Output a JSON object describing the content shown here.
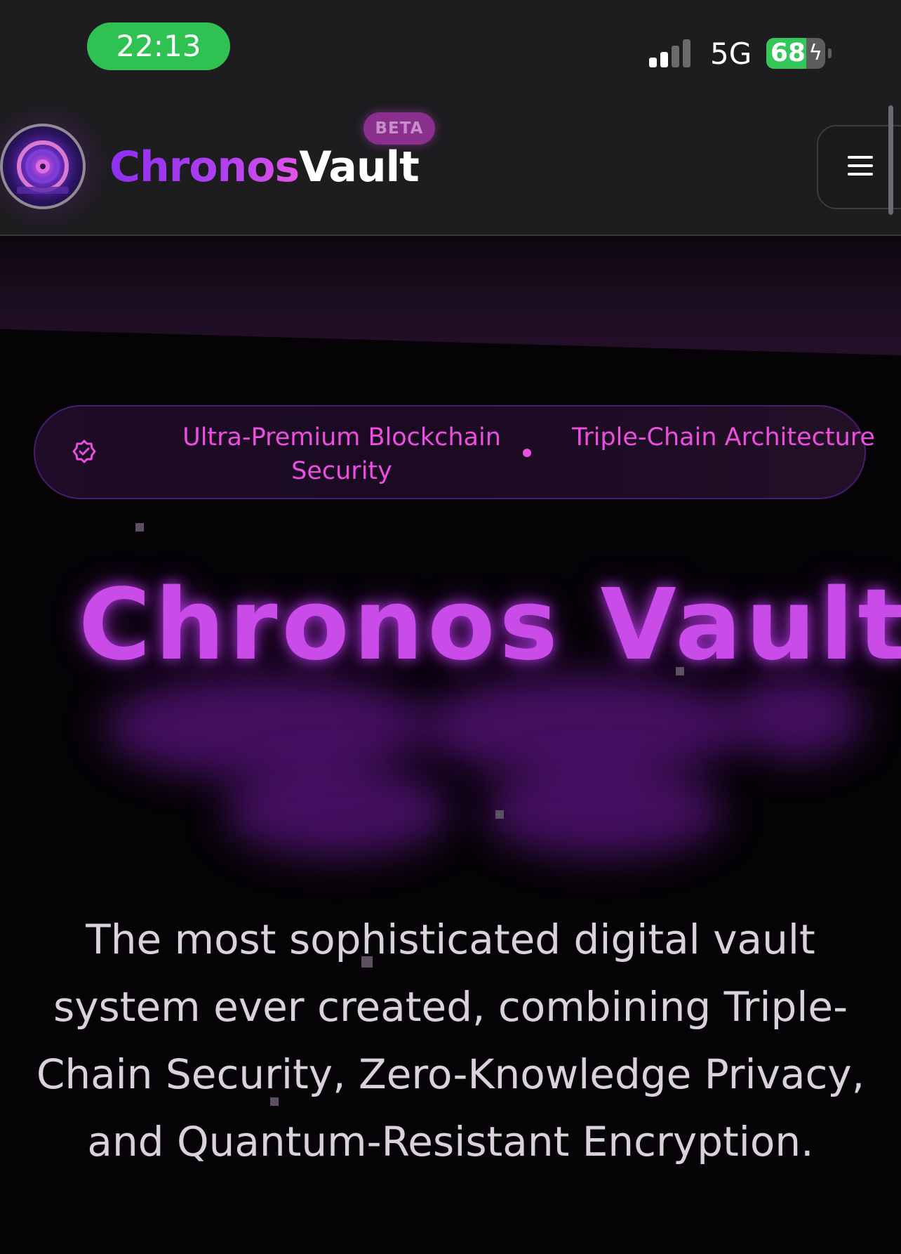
{
  "status_bar": {
    "time": "22:13",
    "network": "5G",
    "battery_level": "68",
    "battery_percent": 68,
    "colors": {
      "time_pill": "#2fc253",
      "battery": "#35c759"
    }
  },
  "header": {
    "brand_part1": "Chronos",
    "brand_part2": "Vault",
    "badge": "BETA",
    "menu_icon": "hamburger-menu-icon",
    "colors": {
      "brand_accent": "#9b35f0",
      "badge": "#8a2f8e"
    }
  },
  "hero": {
    "announcement": {
      "icon": "badge-check-icon",
      "item1": "Ultra-Premium Blockchain Security",
      "item2": "Triple-Chain Architecture",
      "color": "#ec4fe0"
    },
    "title": "Chronos Vault",
    "subtitle": "The most sophisticated digital vault system ever created, combining Triple-Chain Security, Zero-Knowledge Privacy, and Quantum-Resistant Encryption."
  }
}
